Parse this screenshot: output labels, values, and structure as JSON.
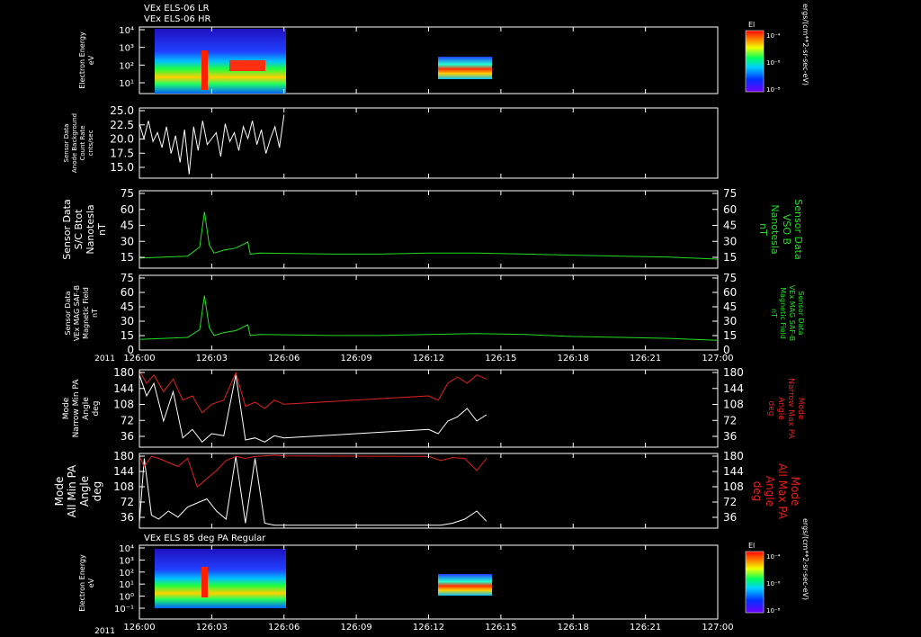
{
  "header": {
    "line1": "VEx ELS-06 LR",
    "line2": "VEx ELS-06 HR"
  },
  "footer_label": "VEx ELS 85 deg PA Regular",
  "year": "2011",
  "colorbar": {
    "title": "El",
    "ticks": [
      "10⁻⁴",
      "10⁻⁶",
      "10⁻⁸"
    ],
    "units": "ergs/(cm**2-sr-sec-eV)"
  },
  "time_ticks": [
    "126:00",
    "126:03",
    "126:06",
    "126:09",
    "126:12",
    "126:15",
    "126:18",
    "126:21",
    "127:00"
  ],
  "colors": {
    "green": "#22dd22",
    "red": "#e02020",
    "white": "#ffffff"
  },
  "panels": {
    "p1": {
      "label": [
        "Electron Energy",
        "eV"
      ],
      "yticks": [
        "10⁴",
        "10³",
        "10²",
        "10¹"
      ]
    },
    "p2": {
      "label": [
        "Sensor Data",
        "Anode Background",
        "Count Rate",
        "cnts/sec"
      ],
      "yticks": [
        "25.0",
        "22.5",
        "20.0",
        "17.5",
        "15.0"
      ]
    },
    "p3": {
      "label": [
        "Sensor Data",
        "S/C Btot",
        "Nanotesla",
        "nT"
      ],
      "right_label": [
        "Sensor Data",
        "VSO B",
        "Nanotesla",
        "nT"
      ],
      "yticks": [
        "75",
        "60",
        "45",
        "30",
        "15"
      ]
    },
    "p4": {
      "label": [
        "Sensor Data",
        "VEx MAG SAF-B",
        "Magnetic Field",
        "nT"
      ],
      "right_label": [
        "Sensor Data",
        "VEx MAG SAF-B",
        "Magnetic Field",
        "nT"
      ],
      "yticks": [
        "75",
        "60",
        "45",
        "30",
        "15",
        "0"
      ]
    },
    "p5": {
      "label": [
        "Mode",
        "Narrow Min PA",
        "Angle",
        "deg"
      ],
      "right_label": [
        "Mode",
        "Narrow Max PA",
        "Angle",
        "deg"
      ],
      "yticks": [
        "180",
        "144",
        "108",
        "72",
        "36"
      ]
    },
    "p6": {
      "label": [
        "Mode",
        "All Min PA",
        "Angle",
        "deg"
      ],
      "right_label": [
        "Mode",
        "All Max PA",
        "Angle",
        "deg"
      ],
      "yticks": [
        "180",
        "144",
        "108",
        "72",
        "36"
      ]
    },
    "p7": {
      "label": [
        "Electron Energy",
        "eV"
      ],
      "yticks": [
        "10⁴",
        "10³",
        "10²",
        "10¹",
        "10⁰",
        "10⁻¹"
      ]
    }
  },
  "chart_data": [
    {
      "type": "heatmap",
      "title": "VEx ELS-06 LR / VEx ELS-06 HR",
      "ylabel": "Electron Energy eV",
      "x_range": [
        "126:00",
        "127:00"
      ],
      "yscale": "log",
      "data_intervals": [
        [
          "126:00",
          "126:06"
        ],
        [
          "126:12",
          "126:14.5"
        ]
      ]
    },
    {
      "type": "line",
      "ylabel": "Sensor Data Anode Background Count Rate cnts/sec",
      "ylim": [
        13.5,
        25
      ],
      "series": [
        {
          "color": "#ffffff",
          "x_range": [
            "126:00",
            "126:06"
          ],
          "values": [
            22.5,
            20,
            23,
            19.5,
            21,
            18.5,
            22,
            17.5,
            20.5,
            16,
            21.5,
            14,
            22,
            18,
            23,
            19,
            20,
            21,
            17,
            22.5,
            19.5,
            21,
            18,
            22,
            20,
            23,
            19,
            21.5,
            17.5,
            20,
            22,
            18.5,
            24
          ]
        }
      ]
    },
    {
      "type": "line",
      "ylabel": "Sensor Data S/C Btot Nanotesla nT",
      "ylim": [
        0,
        75
      ],
      "series": [
        {
          "color": "#22dd22",
          "x": [
            0,
            1,
            2,
            2.5,
            2.7,
            2.9,
            3.1,
            3.5,
            4.0,
            4.5,
            4.6,
            5,
            8,
            10,
            12,
            14,
            16,
            18,
            20,
            22,
            24
          ],
          "values": [
            9,
            10,
            11,
            20,
            55,
            22,
            14,
            17,
            19,
            25,
            13,
            14,
            13,
            13,
            14,
            14,
            13,
            12,
            11,
            10,
            8
          ]
        }
      ]
    },
    {
      "type": "line",
      "ylabel": "Sensor Data VEx MAG SAF-B Magnetic Field nT",
      "ylim": [
        0,
        75
      ],
      "series": [
        {
          "color": "#22dd22",
          "x": [
            0,
            1,
            2,
            2.5,
            2.7,
            2.9,
            3.1,
            3.5,
            4.0,
            4.5,
            4.6,
            5,
            8,
            10,
            12,
            14,
            16,
            18,
            20,
            22,
            24
          ],
          "values": [
            10,
            11,
            12,
            20,
            55,
            22,
            14,
            17,
            19,
            25,
            14,
            15,
            14,
            14,
            15,
            16,
            15,
            13,
            12,
            11,
            9
          ]
        }
      ]
    },
    {
      "type": "line",
      "ylabel": "Mode Narrow Min PA Angle deg",
      "ylim": [
        0,
        180
      ],
      "series": [
        {
          "name": "Narrow Min PA",
          "color": "#ffffff",
          "x": [
            0,
            0.3,
            0.6,
            1.0,
            1.4,
            1.8,
            2.2,
            2.6,
            3.0,
            3.5,
            4.0,
            4.4,
            4.8,
            5.2,
            5.6,
            6.0,
            12.0,
            12.4,
            12.8,
            13.2,
            13.6,
            14.0,
            14.4
          ],
          "values": [
            170,
            120,
            150,
            60,
            130,
            20,
            40,
            10,
            30,
            25,
            170,
            15,
            20,
            10,
            25,
            20,
            40,
            30,
            60,
            70,
            90,
            60,
            75
          ]
        },
        {
          "name": "Narrow Max PA",
          "color": "#e02020",
          "x": [
            0,
            0.3,
            0.6,
            1.0,
            1.4,
            1.8,
            2.2,
            2.6,
            3.0,
            3.5,
            4.0,
            4.4,
            4.8,
            5.2,
            5.6,
            6.0,
            12.0,
            12.4,
            12.8,
            13.2,
            13.6,
            14.0,
            14.4
          ],
          "values": [
            180,
            150,
            170,
            130,
            160,
            110,
            120,
            80,
            100,
            110,
            175,
            95,
            105,
            90,
            110,
            100,
            120,
            110,
            150,
            165,
            150,
            170,
            160
          ]
        }
      ]
    },
    {
      "type": "line",
      "ylabel": "Mode All Min PA Angle deg",
      "ylim": [
        0,
        180
      ],
      "series": [
        {
          "name": "All Min PA",
          "color": "#ffffff",
          "x": [
            0,
            0.2,
            0.5,
            0.8,
            1.2,
            1.6,
            2.0,
            2.4,
            2.8,
            3.2,
            3.6,
            4.0,
            4.4,
            4.8,
            5.2,
            5.6,
            6.0,
            12.0,
            12.5,
            13.0,
            13.5,
            14.0,
            14.4
          ],
          "values": [
            10,
            170,
            30,
            20,
            40,
            25,
            50,
            60,
            70,
            40,
            20,
            175,
            10,
            170,
            10,
            5,
            5,
            5,
            5,
            10,
            20,
            40,
            15
          ]
        },
        {
          "name": "All Max PA",
          "color": "#e02020",
          "x": [
            0,
            0.2,
            0.5,
            0.8,
            1.2,
            1.6,
            2.0,
            2.4,
            2.8,
            3.2,
            3.6,
            4.0,
            4.4,
            4.8,
            5.2,
            5.6,
            6.0,
            12.0,
            12.5,
            13.0,
            13.5,
            14.0,
            14.4
          ],
          "values": [
            175,
            150,
            175,
            170,
            160,
            150,
            170,
            100,
            120,
            140,
            165,
            175,
            170,
            175,
            176,
            178,
            176,
            175,
            165,
            172,
            170,
            140,
            170
          ]
        }
      ]
    },
    {
      "type": "heatmap",
      "title": "VEx ELS 85 deg PA Regular",
      "ylabel": "Electron Energy eV",
      "x_range": [
        "126:00",
        "127:00"
      ],
      "yscale": "log",
      "data_intervals": [
        [
          "126:00",
          "126:06"
        ],
        [
          "126:12",
          "126:14.5"
        ]
      ]
    }
  ]
}
